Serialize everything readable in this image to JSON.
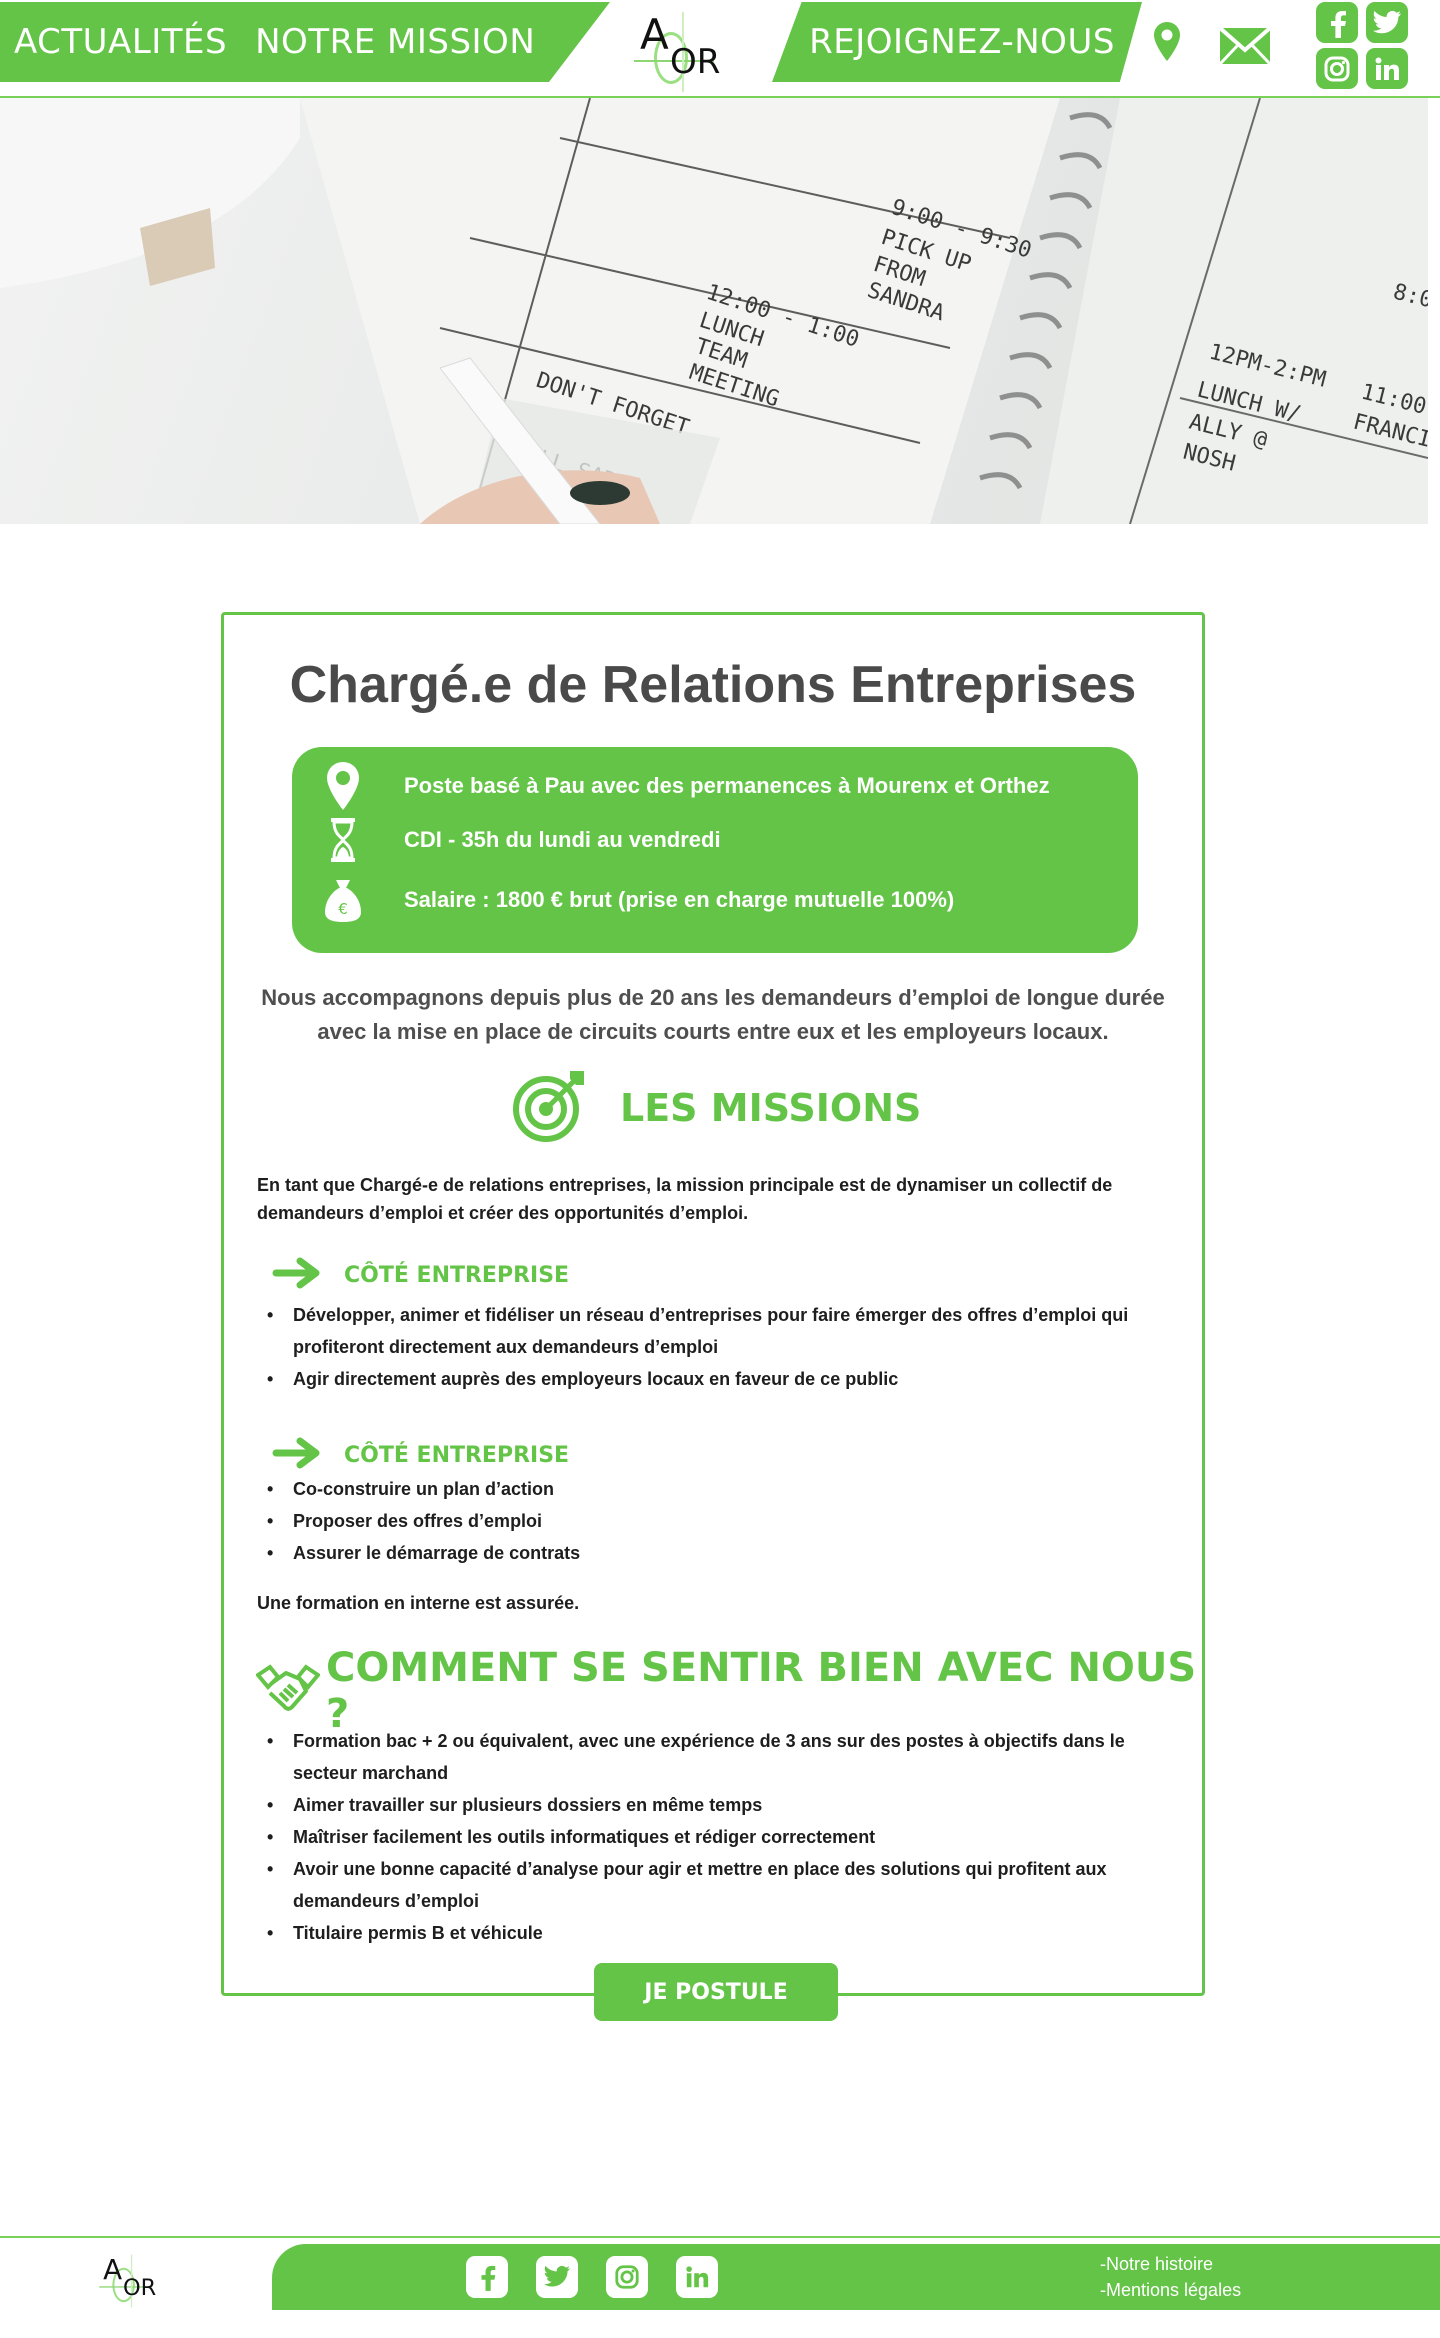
{
  "nav": {
    "news": "ACTUALITÉS",
    "mission": "NOTRE MISSION",
    "join": "REJOIGNEZ-NOUS"
  },
  "brand": {
    "logo_a": "A",
    "logo_or": "OR"
  },
  "icons": {
    "location": "location-pin-icon",
    "mail": "envelope-icon",
    "facebook": "facebook-icon",
    "twitter": "twitter-icon",
    "instagram": "instagram-icon",
    "linkedin": "linkedin-icon"
  },
  "colors": {
    "accent": "#64c447",
    "title": "#4a4a4a",
    "text": "#1e1e1e"
  },
  "job": {
    "title": "Chargé.e de Relations Entreprises",
    "location": "Poste basé à Pau avec des permanences à Mourenx et Orthez",
    "contract": "CDI - 35h du lundi au vendredi",
    "salary": "Salaire : 1800 € brut (prise en charge mutuelle 100%)",
    "intro": "Nous accompagnons depuis plus de 20 ans les demandeurs d’emploi de longue durée avec la mise en place de circuits courts entre eux et les employeurs locaux."
  },
  "missions": {
    "heading": "LES MISSIONS",
    "intro": "En tant que Chargé-e de relations entreprises, la mission principale est de dynamiser un collectif de demandeurs d’emploi et créer des opportunités d’emploi.",
    "section1": {
      "heading": "CÔTÉ ENTREPRISE",
      "items": [
        " Développer, animer et fidéliser un réseau d’entreprises pour faire émerger des offres d’emploi qui profiteront directement aux demandeurs d’emploi",
        "Agir directement auprès des employeurs locaux en faveur de ce public"
      ]
    },
    "section2": {
      "heading": "CÔTÉ ENTREPRISE",
      "items": [
        "Co-construire un plan d’action",
        "Proposer des offres d’emploi",
        "Assurer le démarrage de contrats"
      ]
    },
    "training": "Une formation en interne est assurée."
  },
  "profile": {
    "heading": "COMMENT SE SENTIR BIEN AVEC NOUS ?",
    "items": [
      "Formation bac + 2 ou équivalent, avec une expérience de 3 ans sur des postes à objectifs dans le secteur marchand",
      "Aimer travailler sur plusieurs dossiers en même temps",
      "Maîtriser facilement les outils informatiques et rédiger correctement",
      "Avoir une bonne capacité d’analyse pour agir et mettre en place des solutions qui profitent aux demandeurs d’emploi",
      "Titulaire permis B et véhicule"
    ]
  },
  "cta": {
    "apply": "JE POSTULE"
  },
  "footer": {
    "history": "-Notre histoire",
    "legal": "-Mentions légales"
  }
}
